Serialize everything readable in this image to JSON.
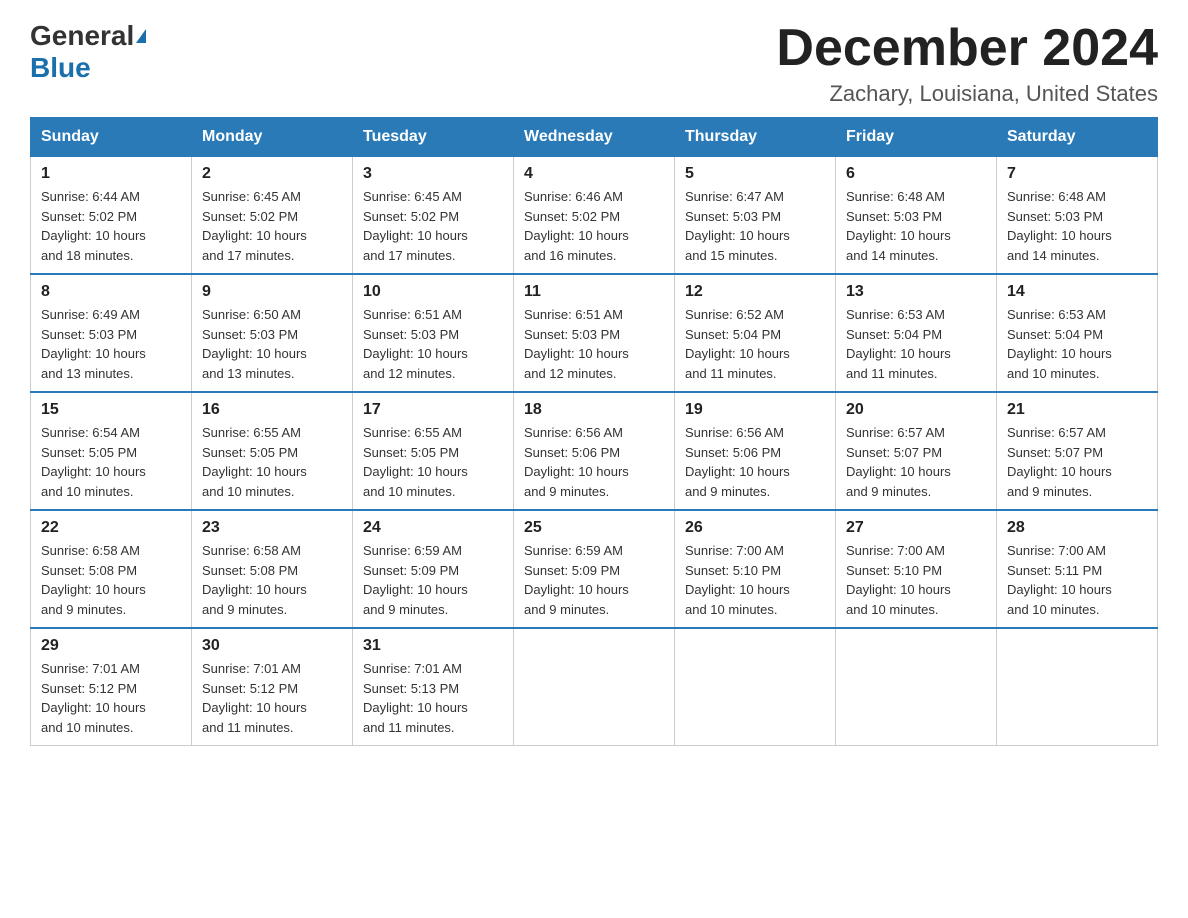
{
  "header": {
    "logo_general": "General",
    "logo_blue": "Blue",
    "month_year": "December 2024",
    "location": "Zachary, Louisiana, United States"
  },
  "days_of_week": [
    "Sunday",
    "Monday",
    "Tuesday",
    "Wednesday",
    "Thursday",
    "Friday",
    "Saturday"
  ],
  "weeks": [
    [
      {
        "num": "1",
        "sunrise": "6:44 AM",
        "sunset": "5:02 PM",
        "daylight": "10 hours and 18 minutes."
      },
      {
        "num": "2",
        "sunrise": "6:45 AM",
        "sunset": "5:02 PM",
        "daylight": "10 hours and 17 minutes."
      },
      {
        "num": "3",
        "sunrise": "6:45 AM",
        "sunset": "5:02 PM",
        "daylight": "10 hours and 17 minutes."
      },
      {
        "num": "4",
        "sunrise": "6:46 AM",
        "sunset": "5:02 PM",
        "daylight": "10 hours and 16 minutes."
      },
      {
        "num": "5",
        "sunrise": "6:47 AM",
        "sunset": "5:03 PM",
        "daylight": "10 hours and 15 minutes."
      },
      {
        "num": "6",
        "sunrise": "6:48 AM",
        "sunset": "5:03 PM",
        "daylight": "10 hours and 14 minutes."
      },
      {
        "num": "7",
        "sunrise": "6:48 AM",
        "sunset": "5:03 PM",
        "daylight": "10 hours and 14 minutes."
      }
    ],
    [
      {
        "num": "8",
        "sunrise": "6:49 AM",
        "sunset": "5:03 PM",
        "daylight": "10 hours and 13 minutes."
      },
      {
        "num": "9",
        "sunrise": "6:50 AM",
        "sunset": "5:03 PM",
        "daylight": "10 hours and 13 minutes."
      },
      {
        "num": "10",
        "sunrise": "6:51 AM",
        "sunset": "5:03 PM",
        "daylight": "10 hours and 12 minutes."
      },
      {
        "num": "11",
        "sunrise": "6:51 AM",
        "sunset": "5:03 PM",
        "daylight": "10 hours and 12 minutes."
      },
      {
        "num": "12",
        "sunrise": "6:52 AM",
        "sunset": "5:04 PM",
        "daylight": "10 hours and 11 minutes."
      },
      {
        "num": "13",
        "sunrise": "6:53 AM",
        "sunset": "5:04 PM",
        "daylight": "10 hours and 11 minutes."
      },
      {
        "num": "14",
        "sunrise": "6:53 AM",
        "sunset": "5:04 PM",
        "daylight": "10 hours and 10 minutes."
      }
    ],
    [
      {
        "num": "15",
        "sunrise": "6:54 AM",
        "sunset": "5:05 PM",
        "daylight": "10 hours and 10 minutes."
      },
      {
        "num": "16",
        "sunrise": "6:55 AM",
        "sunset": "5:05 PM",
        "daylight": "10 hours and 10 minutes."
      },
      {
        "num": "17",
        "sunrise": "6:55 AM",
        "sunset": "5:05 PM",
        "daylight": "10 hours and 10 minutes."
      },
      {
        "num": "18",
        "sunrise": "6:56 AM",
        "sunset": "5:06 PM",
        "daylight": "10 hours and 9 minutes."
      },
      {
        "num": "19",
        "sunrise": "6:56 AM",
        "sunset": "5:06 PM",
        "daylight": "10 hours and 9 minutes."
      },
      {
        "num": "20",
        "sunrise": "6:57 AM",
        "sunset": "5:07 PM",
        "daylight": "10 hours and 9 minutes."
      },
      {
        "num": "21",
        "sunrise": "6:57 AM",
        "sunset": "5:07 PM",
        "daylight": "10 hours and 9 minutes."
      }
    ],
    [
      {
        "num": "22",
        "sunrise": "6:58 AM",
        "sunset": "5:08 PM",
        "daylight": "10 hours and 9 minutes."
      },
      {
        "num": "23",
        "sunrise": "6:58 AM",
        "sunset": "5:08 PM",
        "daylight": "10 hours and 9 minutes."
      },
      {
        "num": "24",
        "sunrise": "6:59 AM",
        "sunset": "5:09 PM",
        "daylight": "10 hours and 9 minutes."
      },
      {
        "num": "25",
        "sunrise": "6:59 AM",
        "sunset": "5:09 PM",
        "daylight": "10 hours and 9 minutes."
      },
      {
        "num": "26",
        "sunrise": "7:00 AM",
        "sunset": "5:10 PM",
        "daylight": "10 hours and 10 minutes."
      },
      {
        "num": "27",
        "sunrise": "7:00 AM",
        "sunset": "5:10 PM",
        "daylight": "10 hours and 10 minutes."
      },
      {
        "num": "28",
        "sunrise": "7:00 AM",
        "sunset": "5:11 PM",
        "daylight": "10 hours and 10 minutes."
      }
    ],
    [
      {
        "num": "29",
        "sunrise": "7:01 AM",
        "sunset": "5:12 PM",
        "daylight": "10 hours and 10 minutes."
      },
      {
        "num": "30",
        "sunrise": "7:01 AM",
        "sunset": "5:12 PM",
        "daylight": "10 hours and 11 minutes."
      },
      {
        "num": "31",
        "sunrise": "7:01 AM",
        "sunset": "5:13 PM",
        "daylight": "10 hours and 11 minutes."
      },
      null,
      null,
      null,
      null
    ]
  ],
  "labels": {
    "sunrise": "Sunrise:",
    "sunset": "Sunset:",
    "daylight": "Daylight:"
  }
}
